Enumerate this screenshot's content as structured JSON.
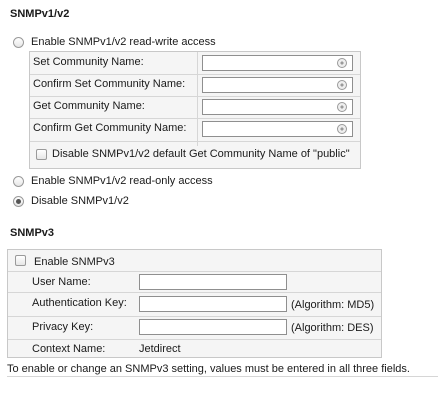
{
  "snmpv12": {
    "heading": "SNMPv1/v2",
    "rw_radio_label": "Enable SNMPv1/v2 read-write access",
    "fields": [
      {
        "label": "Set Community Name:",
        "value": ""
      },
      {
        "label": "Confirm Set Community Name:",
        "value": ""
      },
      {
        "label": "Get Community Name:",
        "value": ""
      },
      {
        "label": "Confirm Get Community Name:",
        "value": ""
      }
    ],
    "disable_public_label": "Disable SNMPv1/v2 default Get Community Name of \"public\"",
    "ro_radio_label": "Enable SNMPv1/v2 read-only access",
    "disable_radio_label": "Disable SNMPv1/v2",
    "selected": "disable"
  },
  "snmpv3": {
    "heading": "SNMPv3",
    "enable_label": "Enable SNMPv3",
    "user_name_label": "User Name:",
    "user_name_value": "",
    "auth_key_label": "Authentication Key:",
    "auth_key_value": "",
    "auth_algorithm": "(Algorithm: MD5)",
    "privacy_key_label": "Privacy Key:",
    "privacy_key_value": "",
    "privacy_algorithm": "(Algorithm: DES)",
    "context_name_label": "Context Name:",
    "context_name_value": "Jetdirect"
  },
  "note": "To enable or change an SNMPv3 setting, values must be entered in all three fields."
}
